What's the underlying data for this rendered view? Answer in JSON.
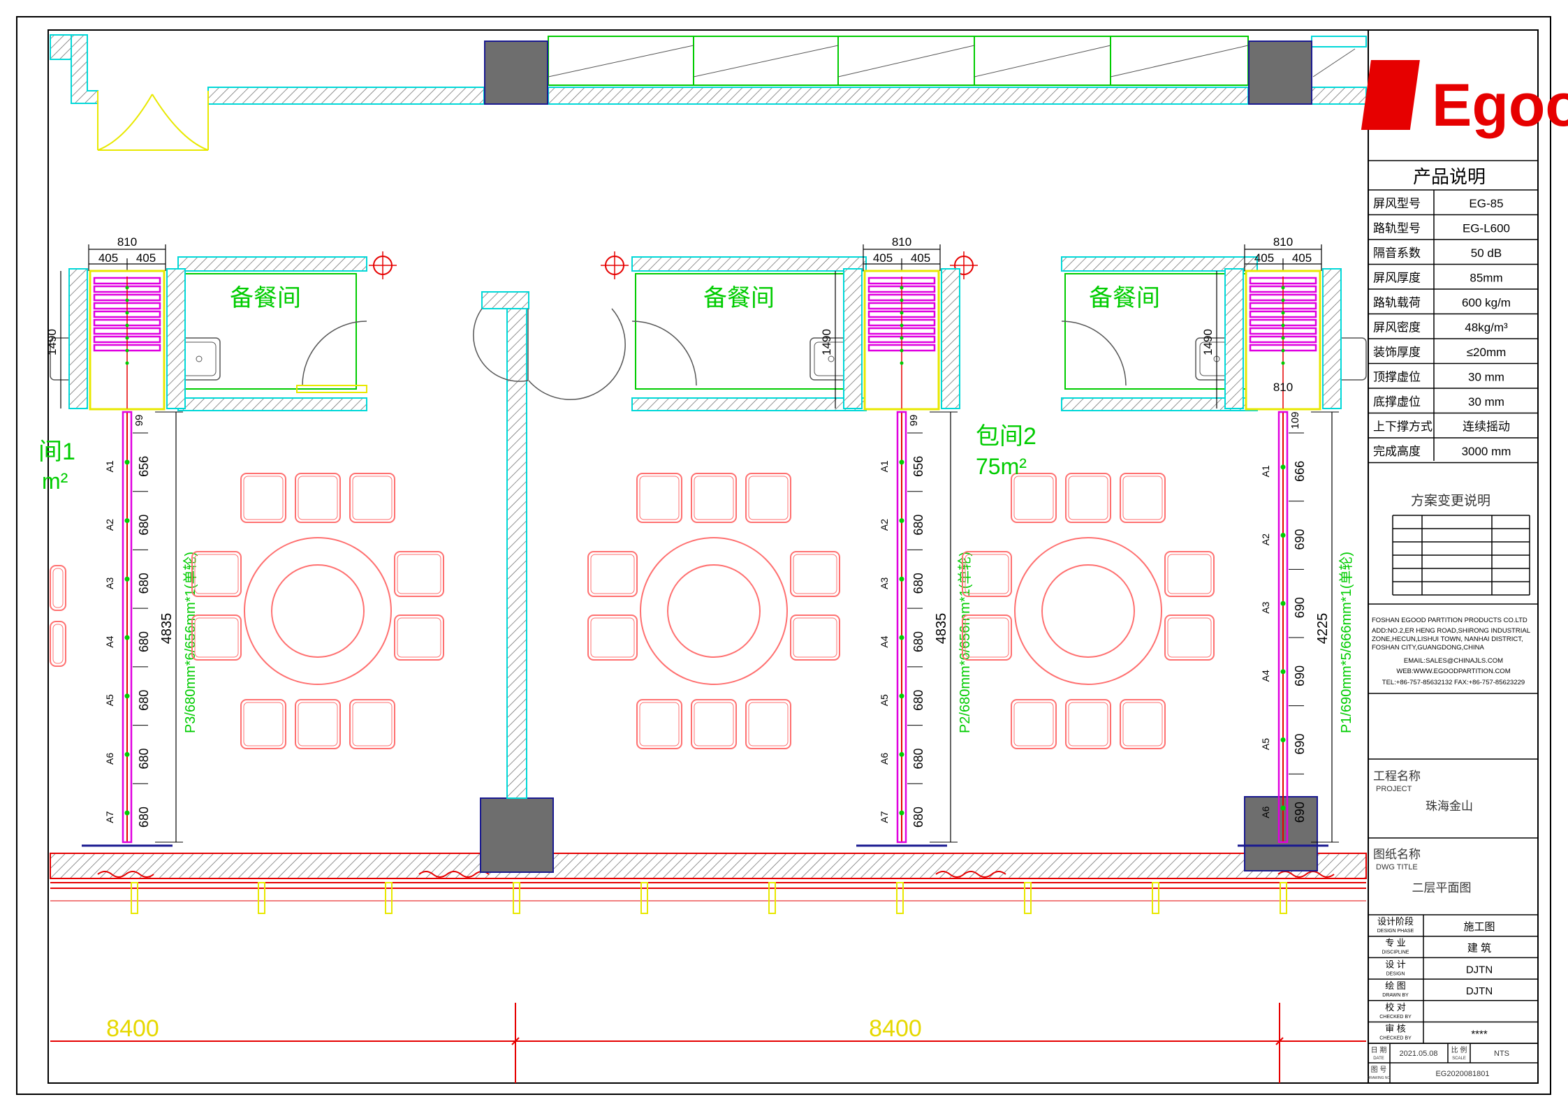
{
  "drawing": {
    "room_labels": [
      "备餐间",
      "备餐间",
      "备餐间"
    ],
    "room1_label": "间1",
    "room1_area": "m²",
    "room2_label": "包间2",
    "room2_area": "75m²",
    "dim_8400_left": "8400",
    "dim_8400_right": "8400",
    "p3_label": "P3/680mm*6/656mm*1(单轮)",
    "p2_label": "P2/680mm*6/656mm*1(单轮)",
    "p1_label": "P1/690mm*5/666mm*1(单轮)",
    "total_left": "4835",
    "total_mid": "4835",
    "total_right": "4225",
    "top_dim": "810",
    "half_dim": "405",
    "height_dim": "1490",
    "bottom_810": "810",
    "dims_p3": [
      "656",
      "680",
      "680",
      "680",
      "680",
      "680",
      "680"
    ],
    "dims_p2": [
      "656",
      "680",
      "680",
      "680",
      "680",
      "680",
      "680"
    ],
    "dims_p1": [
      "666",
      "690",
      "690",
      "690",
      "690",
      "690"
    ],
    "offset_small": "99",
    "offset_small_right": "109",
    "panel_tags_p3": [
      "A1",
      "A2",
      "A3",
      "A4",
      "A5",
      "A6",
      "A7"
    ],
    "panel_tags_p2": [
      "A1",
      "A2",
      "A3",
      "A4",
      "A5",
      "A6",
      "A7"
    ],
    "panel_tags_p1": [
      "A1",
      "A2",
      "A3",
      "A4",
      "A5",
      "A6"
    ]
  },
  "titleblock": {
    "logo": "Egood",
    "product_header": "产品说明",
    "specs": [
      {
        "label": "屏风型号",
        "value": "EG-85"
      },
      {
        "label": "路轨型号",
        "value": "EG-L600"
      },
      {
        "label": "隔音系数",
        "value": "50 dB"
      },
      {
        "label": "屏风厚度",
        "value": "85mm"
      },
      {
        "label": "路轨载荷",
        "value": "600 kg/m"
      },
      {
        "label": "屏风密度",
        "value": "48kg/m³"
      },
      {
        "label": "装饰厚度",
        "value": "≤20mm"
      },
      {
        "label": "顶撑虚位",
        "value": "30 mm"
      },
      {
        "label": "底撑虚位",
        "value": "30 mm"
      },
      {
        "label": "上下撑方式",
        "value": "连续摇动"
      },
      {
        "label": "完成高度",
        "value": "3000 mm"
      }
    ],
    "change_header": "方案变更说明",
    "company_lines": [
      "FOSHAN EGOOD PARTITION PRODUCTS CO.LTD",
      "ADD:NO.2,ER HENG ROAD,SHIRONG INDUSTRIAL",
      "ZONE,HECUN,LISHUI TOWN, NANHAI DISTRICT,",
      "FOSHAN CITY,GUANGDONG,CHINA",
      "EMAIL:SALES@CHINAJLS.COM",
      "WEB:WWW.EGOODPARTITION.COM",
      "TEL:+86-757-85632132  FAX:+86-757-85623229"
    ],
    "project_label_cn": "工程名称",
    "project_label_en": "PROJECT",
    "project_value": "珠海金山",
    "dwg_label_cn": "图纸名称",
    "dwg_label_en": "DWG TITLE",
    "dwg_value": "二层平面图",
    "rows": [
      {
        "cn": "设计阶段",
        "en": "DESIGN PHASE",
        "value": "施工图"
      },
      {
        "cn": "专 业",
        "en": "DISCIPLINE",
        "value": "建 筑"
      },
      {
        "cn": "设 计",
        "en": "DESIGN",
        "value": "DJTN"
      },
      {
        "cn": "绘 图",
        "en": "DRAWN BY",
        "value": "DJTN"
      },
      {
        "cn": "校 对",
        "en": "CHECKED BY",
        "value": ""
      },
      {
        "cn": "审 核",
        "en": "CHECKED BY",
        "value": "****"
      }
    ],
    "date_cn": "日 期",
    "date_en": "DATE",
    "date_value": "2021.05.08",
    "scale_cn": "比 例",
    "scale_en": "SCALE",
    "scale_value": "NTS",
    "dwgno_cn": "图 号",
    "dwgno_en": "DRAWING NO",
    "dwgno_value": "EG2020081801"
  },
  "colors": {
    "wall_cyan": "#00d8d8",
    "hatch": "#707070",
    "green": "#00cc00",
    "magenta": "#e000e0",
    "red": "#e60000",
    "yellow": "#e8e800",
    "dim_yellow": "#e6d800",
    "navy": "#1a1a90",
    "column": "#6e6e6e",
    "furniture": "#ff7070"
  }
}
